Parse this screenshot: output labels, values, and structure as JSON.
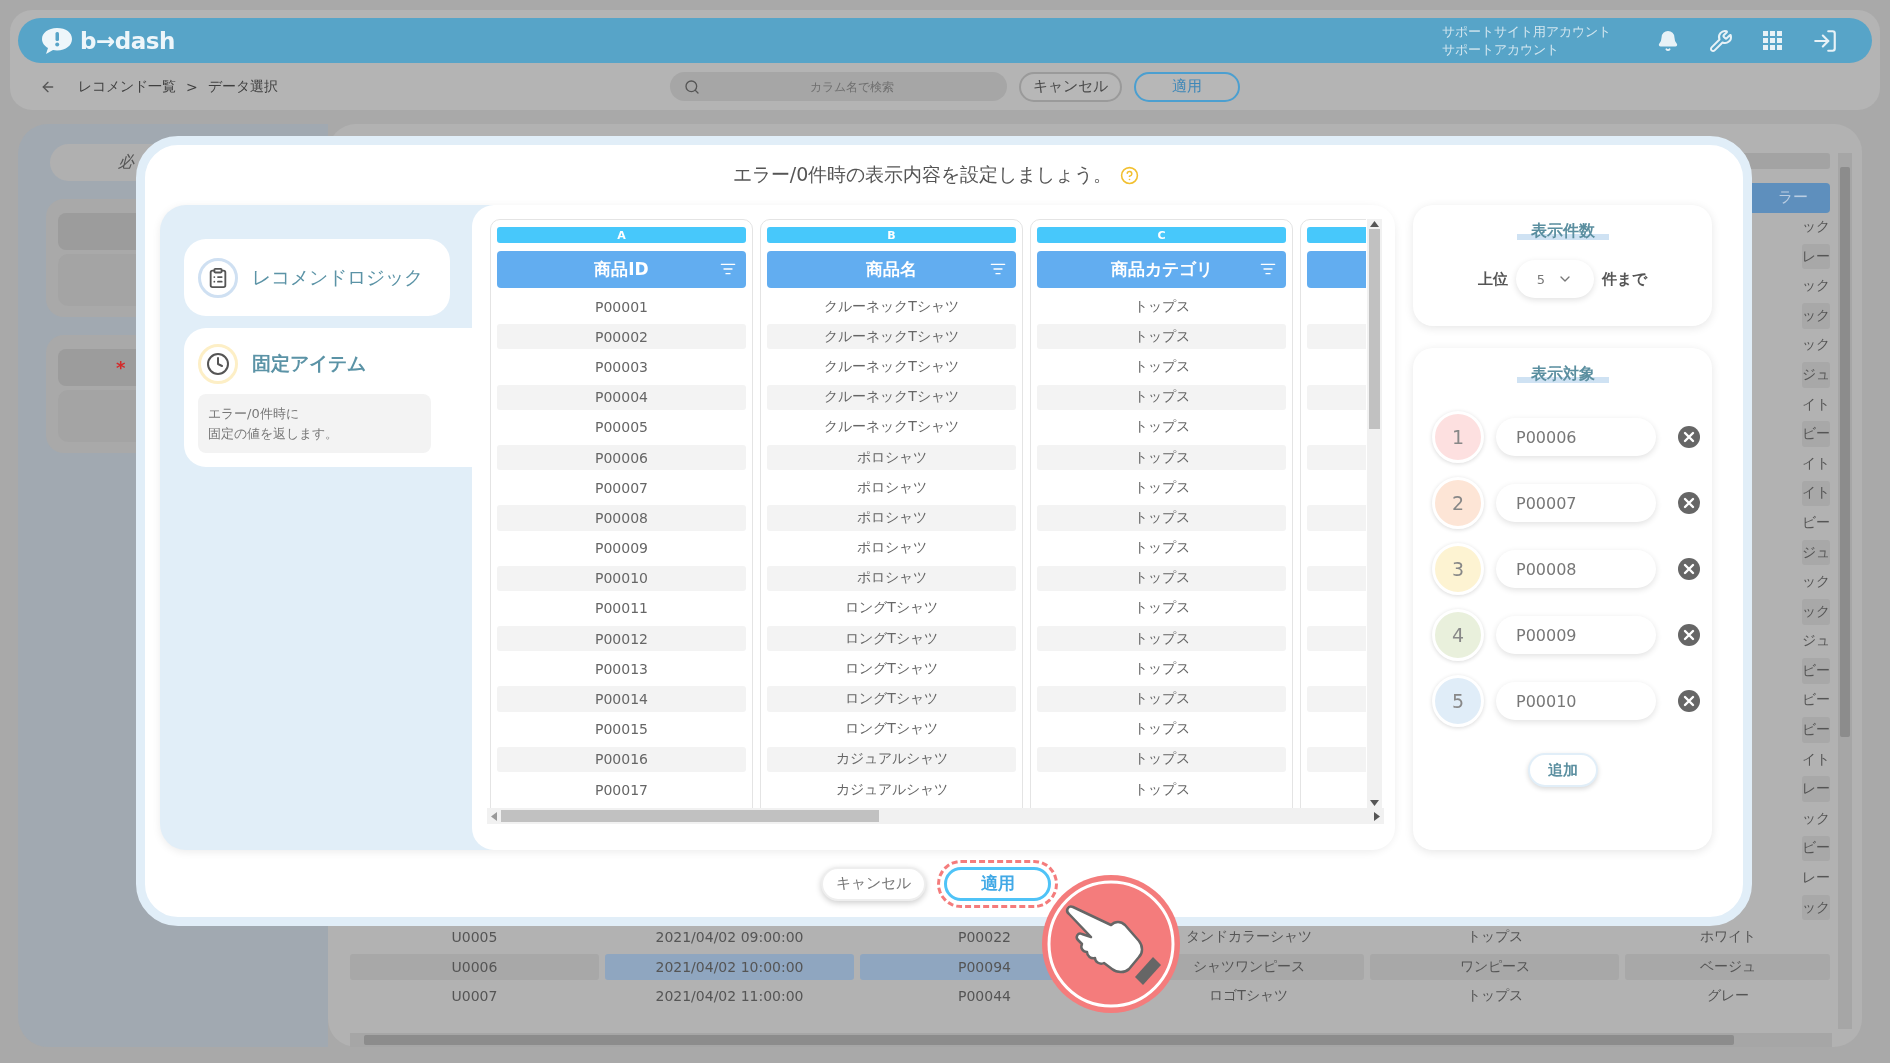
{
  "header": {
    "logo": "b→dash",
    "account_lines": [
      "サポートサイト用アカウント",
      "サポートアカウント"
    ]
  },
  "breadcrumb": {
    "items": [
      "レコメンド一覧",
      "データ選択"
    ],
    "separator": ">"
  },
  "search": {
    "placeholder": "カラム名で検索"
  },
  "toolbar_buttons": [
    {
      "label": "キャンセル",
      "kind": "secondary"
    },
    {
      "label": "適用",
      "kind": "primary"
    }
  ],
  "sidebar": {
    "pill_fragment": "必",
    "mark": "*"
  },
  "background_table": {
    "columns": [
      {
        "selected": false
      },
      {
        "selected": true
      },
      {
        "selected": true
      },
      {
        "selected": false
      },
      {
        "selected": false
      },
      {
        "selected": false,
        "header_fragment": "ラー"
      }
    ],
    "rows": [
      {
        "fragment": "ック"
      },
      {
        "fragment": "レー"
      },
      {
        "fragment": "ック"
      },
      {
        "fragment": "ック"
      },
      {
        "fragment": "ック"
      },
      {
        "fragment": "ジュ"
      },
      {
        "fragment": "イト"
      },
      {
        "fragment": "ビー"
      },
      {
        "fragment": "イト"
      },
      {
        "fragment": "イト"
      },
      {
        "fragment": "ビー"
      },
      {
        "fragment": "ジュ"
      },
      {
        "fragment": "ック"
      },
      {
        "fragment": "ック"
      },
      {
        "fragment": "ジュ"
      },
      {
        "fragment": "ビー"
      },
      {
        "fragment": "ビー"
      },
      {
        "fragment": "ビー"
      },
      {
        "fragment": "イト"
      },
      {
        "fragment": "レー"
      },
      {
        "fragment": "ック"
      },
      {
        "fragment": "ビー"
      },
      {
        "fragment": "レー"
      },
      {
        "fragment": "ック"
      },
      {
        "cells": [
          "U0005",
          "2021/04/02 09:00:00",
          "P00022",
          "タンドカラーシャツ",
          "トップス",
          "ホワイト"
        ]
      },
      {
        "cells": [
          "U0006",
          "2021/04/02 10:00:00",
          "P00094",
          "シャツワンピース",
          "ワンピース",
          "ベージュ"
        ]
      },
      {
        "cells": [
          "U0007",
          "2021/04/02 11:00:00",
          "P00044",
          "ロゴTシャツ",
          "トップス",
          "グレー"
        ]
      }
    ]
  },
  "modal": {
    "title": "エラー/0件時の表示内容を設定しましょう。",
    "menu": [
      {
        "label": "レコメンドロジック",
        "kind": "logic",
        "selected": false
      },
      {
        "label": "固定アイテム",
        "kind": "fixed",
        "selected": true,
        "description": [
          "エラー/0件時に",
          "固定の値を返します。"
        ]
      }
    ],
    "table": {
      "columns": [
        {
          "kind": "full",
          "letter": "A",
          "header": "商品ID"
        },
        {
          "kind": "full",
          "letter": "B",
          "header": "商品名"
        },
        {
          "kind": "full",
          "letter": "C",
          "header": "商品カテゴリ"
        },
        {
          "kind": "cut"
        }
      ],
      "rows": [
        {
          "cells": [
            "P00001",
            "クルーネックTシャツ",
            "トップス"
          ]
        },
        {
          "cells": [
            "P00002",
            "クルーネックTシャツ",
            "トップス"
          ]
        },
        {
          "cells": [
            "P00003",
            "クルーネックTシャツ",
            "トップス"
          ]
        },
        {
          "cells": [
            "P00004",
            "クルーネックTシャツ",
            "トップス"
          ]
        },
        {
          "cells": [
            "P00005",
            "クルーネックTシャツ",
            "トップス"
          ]
        },
        {
          "cells": [
            "P00006",
            "ポロシャツ",
            "トップス"
          ]
        },
        {
          "cells": [
            "P00007",
            "ポロシャツ",
            "トップス"
          ]
        },
        {
          "cells": [
            "P00008",
            "ポロシャツ",
            "トップス"
          ]
        },
        {
          "cells": [
            "P00009",
            "ポロシャツ",
            "トップス"
          ]
        },
        {
          "cells": [
            "P00010",
            "ポロシャツ",
            "トップス"
          ]
        },
        {
          "cells": [
            "P00011",
            "ロングTシャツ",
            "トップス"
          ]
        },
        {
          "cells": [
            "P00012",
            "ロングTシャツ",
            "トップス"
          ]
        },
        {
          "cells": [
            "P00013",
            "ロングTシャツ",
            "トップス"
          ]
        },
        {
          "cells": [
            "P00014",
            "ロングTシャツ",
            "トップス"
          ]
        },
        {
          "cells": [
            "P00015",
            "ロングTシャツ",
            "トップス"
          ]
        },
        {
          "cells": [
            "P00016",
            "カジュアルシャツ",
            "トップス"
          ]
        },
        {
          "cells": [
            "P00017",
            "カジュアルシャツ",
            "トップス"
          ]
        }
      ]
    },
    "count_panel": {
      "title": "表示件数",
      "prefix": "上位",
      "value": "5",
      "suffix": "件まで"
    },
    "items_panel": {
      "title": "表示対象",
      "items": [
        {
          "number": "1",
          "value": "P00006",
          "color": "#fde0e0"
        },
        {
          "number": "2",
          "value": "P00007",
          "color": "#fde5d6"
        },
        {
          "number": "3",
          "value": "P00008",
          "color": "#fdf3d2"
        },
        {
          "number": "4",
          "value": "P00009",
          "color": "#e9f0dc"
        },
        {
          "number": "5",
          "value": "P00010",
          "color": "#e0edf8"
        }
      ],
      "add_label": "追加"
    },
    "footer_buttons": [
      {
        "label": "キャンセル",
        "kind": "secondary",
        "highlighted": false
      },
      {
        "label": "適用",
        "kind": "primary",
        "highlighted": true
      }
    ]
  }
}
